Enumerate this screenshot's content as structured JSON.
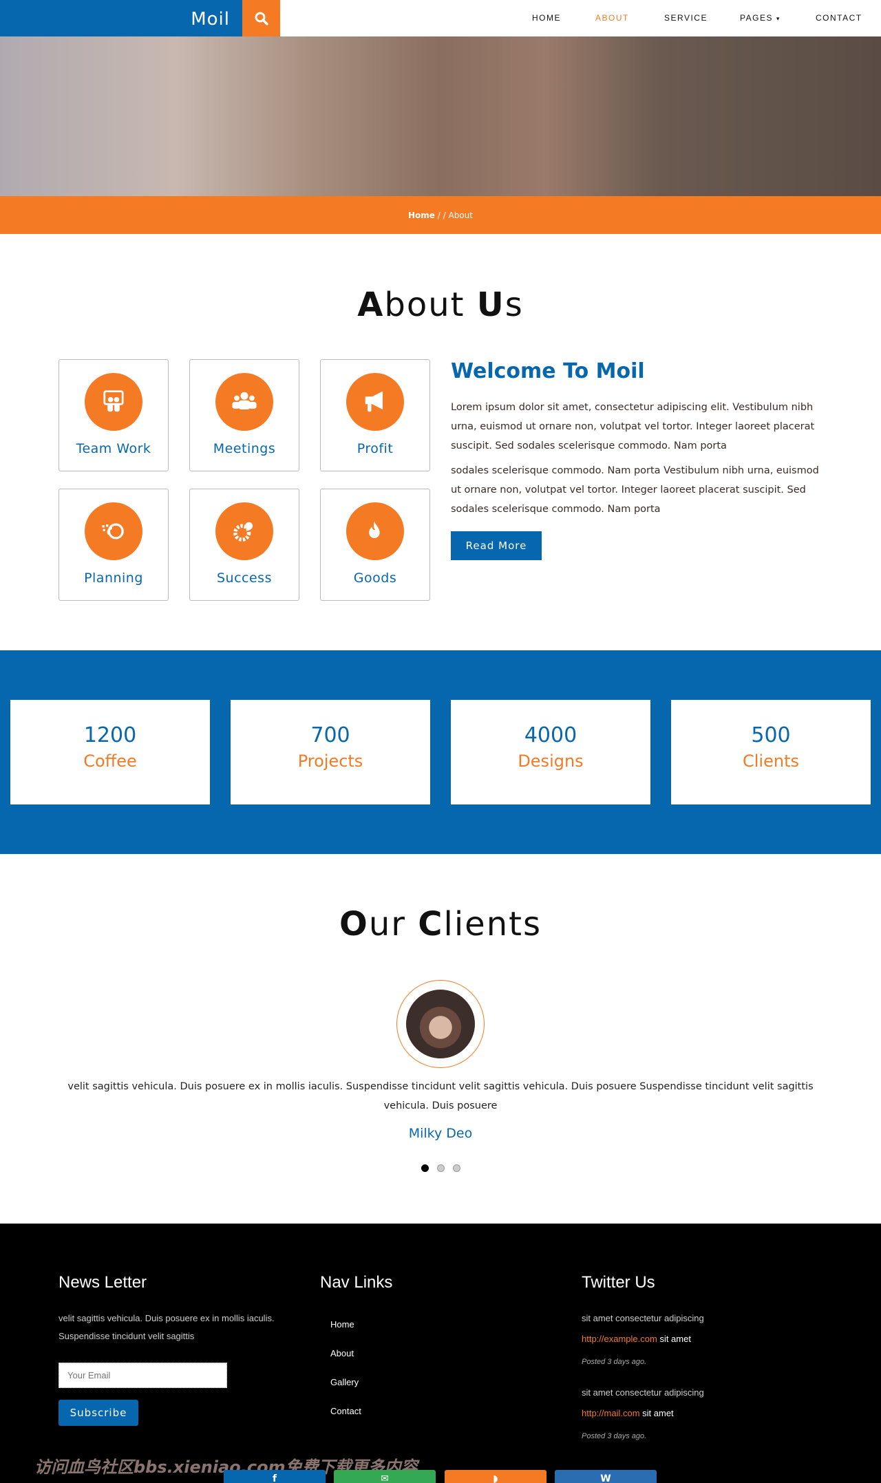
{
  "nav": {
    "brand": "Moil",
    "links": [
      "HOME",
      "ABOUT",
      "SERVICE",
      "PAGES",
      "CONTACT"
    ],
    "active": "ABOUT",
    "pages_caret": "▾"
  },
  "breadcrumb": {
    "home": "Home",
    "sep": " / / ",
    "current": "About"
  },
  "about": {
    "title_first": "A",
    "title_rest1": "bout ",
    "title_u": "U",
    "title_rest2": "s",
    "features": [
      {
        "label": "Team Work",
        "icon": "team-icon"
      },
      {
        "label": "Meetings",
        "icon": "group-icon"
      },
      {
        "label": "Profit",
        "icon": "megaphone-icon"
      },
      {
        "label": "Planning",
        "icon": "cloud-icon"
      },
      {
        "label": "Success",
        "icon": "gears-icon"
      },
      {
        "label": "Goods",
        "icon": "flame-icon"
      }
    ],
    "welcome": "Welcome To Moil",
    "p1": "Lorem ipsum dolor sit amet, consectetur adipiscing elit. Vestibulum nibh urna, euismod ut ornare non, volutpat vel tortor. Integer laoreet placerat suscipit. Sed sodales scelerisque commodo. Nam porta",
    "p2": "sodales scelerisque commodo. Nam porta Vestibulum nibh urna, euismod ut ornare non, volutpat vel tortor. Integer laoreet placerat suscipit. Sed sodales scelerisque commodo. Nam porta",
    "read_more": "Read More"
  },
  "stats": [
    {
      "num": "1200",
      "label": "Coffee"
    },
    {
      "num": "700",
      "label": "Projects"
    },
    {
      "num": "4000",
      "label": "Designs"
    },
    {
      "num": "500",
      "label": "Clients"
    }
  ],
  "clients": {
    "title_o": "O",
    "title_r1": "ur ",
    "title_c": "C",
    "title_r2": "lients",
    "quote": "velit sagittis vehicula. Duis posuere ex in mollis iaculis. Suspendisse tincidunt velit sagittis vehicula. Duis posuere Suspendisse tincidunt velit sagittis vehicula. Duis posuere",
    "name": "Milky Deo",
    "slides": 3,
    "active_slide": 1
  },
  "footer": {
    "newsletter": {
      "title": "News Letter",
      "text": "velit sagittis vehicula. Duis posuere ex in mollis iaculis. Suspendisse tincidunt velit sagittis",
      "placeholder": "Your Email",
      "button": "Subscribe"
    },
    "nav": {
      "title": "Nav Links",
      "links": [
        "Home",
        "About",
        "Gallery",
        "Contact"
      ]
    },
    "twitter": {
      "title": "Twitter Us",
      "tweets": [
        {
          "text": "sit amet consectetur adipiscing",
          "link": "http://example.com",
          "after": " sit amet",
          "posted": "Posted 3 days ago."
        },
        {
          "text": "sit amet consectetur adipiscing",
          "link": "http://mail.com",
          "after": " sit amet",
          "posted": "Posted 3 days ago."
        }
      ]
    },
    "social": [
      {
        "icon": "facebook-icon",
        "glyph": "f",
        "color": "#0767ae"
      },
      {
        "icon": "mail-icon",
        "glyph": "✉",
        "color": "#34a853"
      },
      {
        "icon": "rss-icon",
        "glyph": "◗",
        "color": "#f47a24"
      },
      {
        "icon": "vk-icon",
        "glyph": "W",
        "color": "#2a6db0"
      }
    ]
  },
  "watermark": "访问血鸟社区bbs.xieniao.com免费下载更多内容",
  "colors": {
    "primary": "#0767ae",
    "accent": "#f47a24",
    "footer": "#000000"
  }
}
